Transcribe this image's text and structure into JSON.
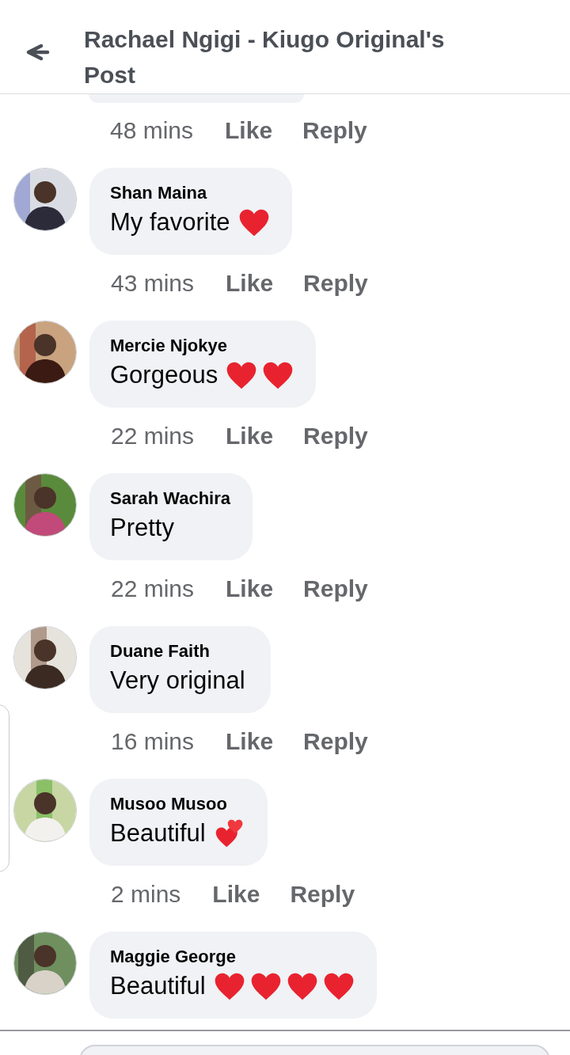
{
  "header": {
    "title": "Rachael Ngigi - Kiugo Original's Post"
  },
  "previous_comment": {
    "time": "48 mins",
    "like": "Like",
    "reply": "Reply"
  },
  "comments": [
    {
      "author": "Shan Maina",
      "text": "My favorite",
      "emoji": [
        {
          "kind": "heart"
        }
      ],
      "time": "43 mins",
      "like": "Like",
      "reply": "Reply",
      "avatar": {
        "kind": "picture"
      }
    },
    {
      "author": "Mercie Njokye",
      "text": "Gorgeous",
      "emoji": [
        {
          "kind": "heart"
        },
        {
          "kind": "heart"
        }
      ],
      "time": "22 mins",
      "like": "Like",
      "reply": "Reply",
      "avatar": {
        "kind": "picture"
      }
    },
    {
      "author": "Sarah Wachira",
      "text": "Pretty",
      "time": "22 mins",
      "like": "Like",
      "reply": "Reply",
      "avatar": {
        "kind": "picture"
      }
    },
    {
      "author": "Duane Faith",
      "text": "Very original",
      "time": "16 mins",
      "like": "Like",
      "reply": "Reply",
      "avatar": {
        "kind": "picture"
      }
    },
    {
      "author": "Musoo Musoo",
      "text": "Beautiful",
      "emoji": [
        {
          "kind": "two-hearts"
        }
      ],
      "time": "2 mins",
      "like": "Like",
      "reply": "Reply",
      "avatar": {
        "kind": "picture"
      }
    },
    {
      "author": "Maggie George",
      "text": "Beautiful",
      "emoji": [
        {
          "kind": "heart"
        },
        {
          "kind": "heart"
        },
        {
          "kind": "heart"
        },
        {
          "kind": "heart"
        }
      ],
      "avatar": {
        "kind": "picture"
      }
    }
  ]
}
